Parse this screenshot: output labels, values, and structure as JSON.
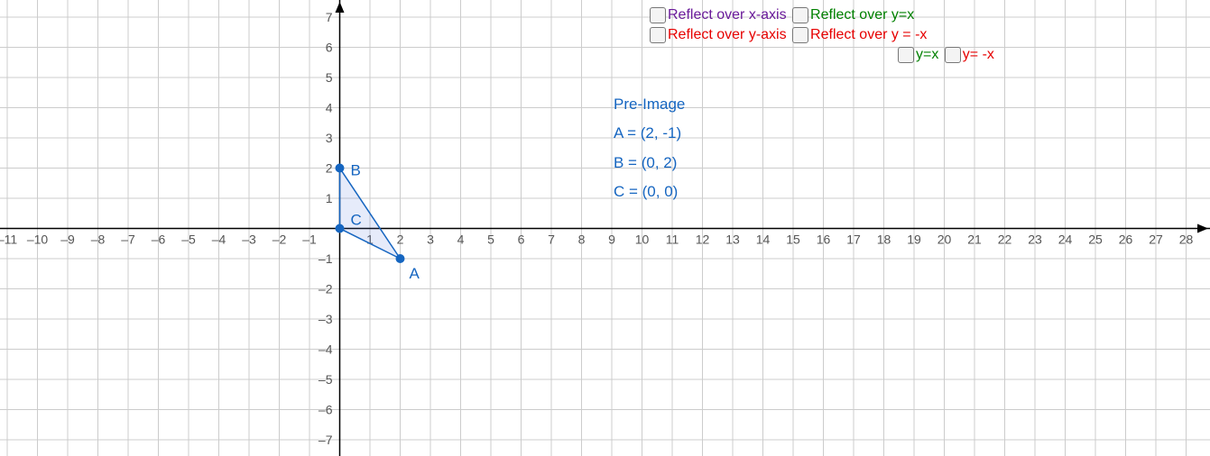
{
  "chart_data": {
    "type": "scatter",
    "title": "",
    "xlabel": "",
    "ylabel": "",
    "xlim": [
      -11,
      28
    ],
    "ylim": [
      -7,
      7
    ],
    "grid": true,
    "triangle": {
      "points": [
        {
          "name": "A",
          "x": 2,
          "y": -1
        },
        {
          "name": "B",
          "x": 0,
          "y": 2
        },
        {
          "name": "C",
          "x": 0,
          "y": 0
        }
      ],
      "fill": "#5577dd",
      "fill_opacity": 0.15,
      "stroke": "#1565C0"
    },
    "x_ticks": [
      -11,
      -10,
      -9,
      -8,
      -7,
      -6,
      -5,
      -4,
      -3,
      -2,
      -1,
      1,
      2,
      3,
      4,
      5,
      6,
      7,
      8,
      9,
      10,
      11,
      12,
      13,
      14,
      15,
      16,
      17,
      18,
      19,
      20,
      21,
      22,
      23,
      24,
      25,
      26,
      27,
      28
    ],
    "y_ticks": [
      -7,
      -6,
      -5,
      -4,
      -3,
      -2,
      -1,
      1,
      2,
      3,
      4,
      5,
      6,
      7
    ]
  },
  "checkboxes": {
    "reflect_x": "Reflect over x-axis",
    "reflect_y": "Reflect over y-axis",
    "reflect_yx": "Reflect over y=x",
    "reflect_ynx": "Reflect over y = -x",
    "line_yx": "y=x",
    "line_ynx": "y= -x"
  },
  "preimage": {
    "title": "Pre-Image",
    "A": "A = (2, -1)",
    "B": "B = (0, 2)",
    "C": "C = (0, 0)"
  }
}
